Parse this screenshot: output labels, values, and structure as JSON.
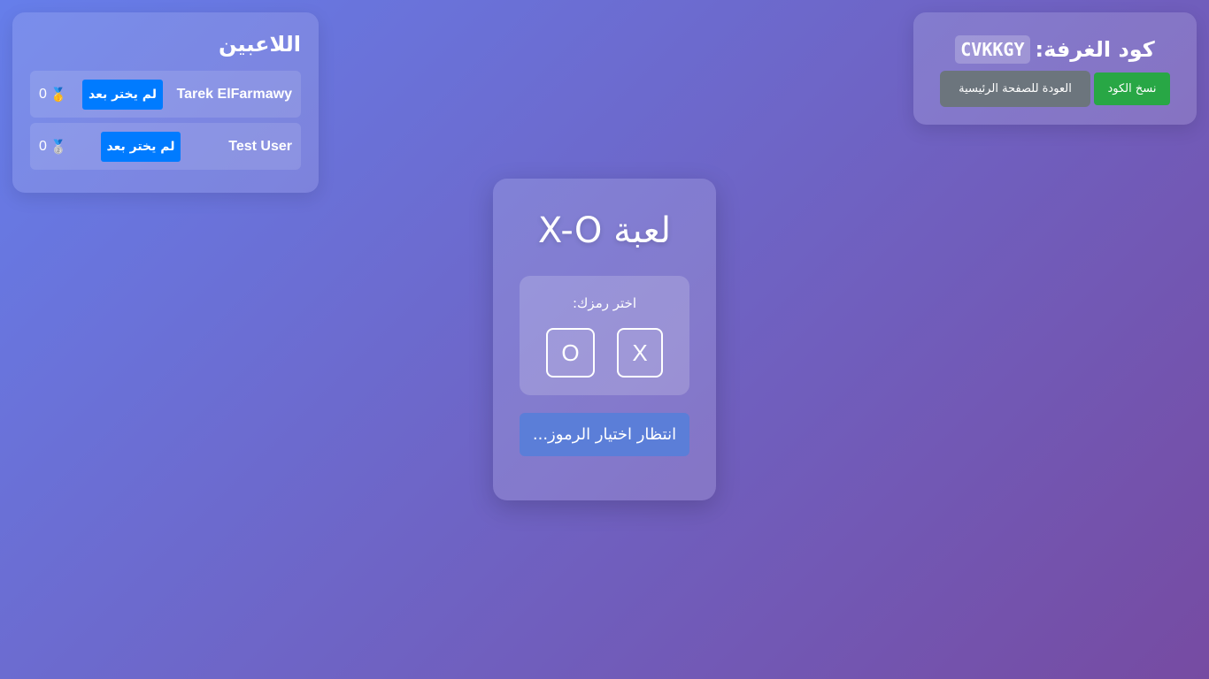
{
  "room": {
    "title_label": "كود الغرفة:",
    "code": "CVKKGY",
    "copy_button": "نسخ الكود",
    "home_button": "العودة للصفحة الرئيسية"
  },
  "players": {
    "title": "اللاعبين",
    "items": [
      {
        "name": "Tarek ElFarmawy",
        "status": "لم يختر بعد",
        "medal": "🥇",
        "score": "0"
      },
      {
        "name": "Test User",
        "status": "لم يختر بعد",
        "medal": "🥈",
        "score": "0"
      }
    ]
  },
  "game": {
    "title": "لعبة X-O",
    "prompt": "اختر رمزك:",
    "symbols": [
      "X",
      "O"
    ],
    "wait_button": "انتظار اختيار الرموز..."
  },
  "colors": {
    "background_start": "#667eea",
    "background_end": "#764ba2",
    "copy_button": "#28a745",
    "home_button": "#6c757d",
    "status_badge": "#007bff",
    "wait_button": "#5b7ed8"
  },
  "icons": {
    "first_place": "gold-medal-icon",
    "second_place": "silver-medal-icon"
  }
}
